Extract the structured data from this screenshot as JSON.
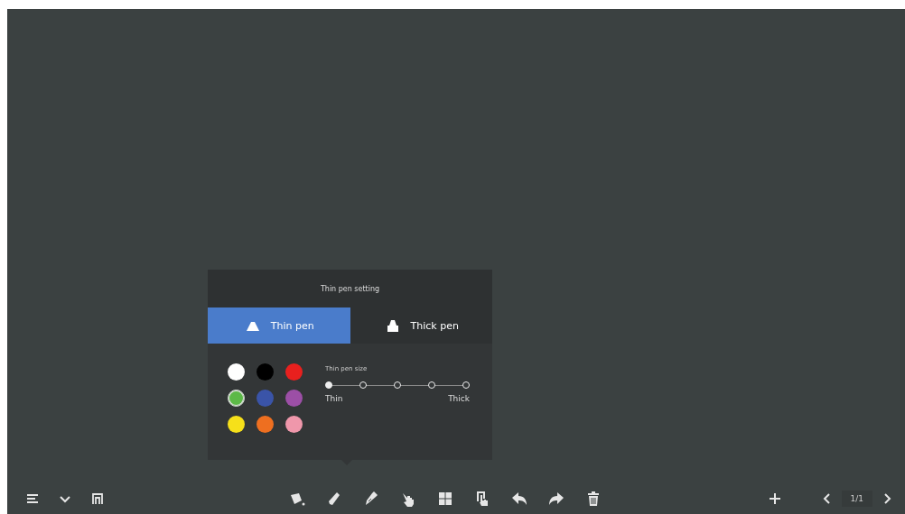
{
  "pen_panel": {
    "title": "Thin pen setting",
    "tabs": [
      {
        "label": "Thin pen",
        "selected": true
      },
      {
        "label": "Thick pen",
        "selected": false
      }
    ],
    "colors": [
      {
        "color": "#ffffff",
        "selected": false
      },
      {
        "color": "#000000",
        "selected": false
      },
      {
        "color": "#e8201e",
        "selected": false
      },
      {
        "color": "#5cb947",
        "selected": true
      },
      {
        "color": "#3a54a8",
        "selected": false
      },
      {
        "color": "#9c4fa6",
        "selected": false
      },
      {
        "color": "#f6e01a",
        "selected": false
      },
      {
        "color": "#ee6f20",
        "selected": false
      },
      {
        "color": "#ef97ab",
        "selected": false
      }
    ],
    "size_label": "Thin pen size",
    "sizes": [
      {
        "selected": true
      },
      {
        "selected": false
      },
      {
        "selected": false
      },
      {
        "selected": false
      },
      {
        "selected": false
      }
    ],
    "min_label": "Thin",
    "max_label": "Thick"
  },
  "page_indicator": "1/1"
}
